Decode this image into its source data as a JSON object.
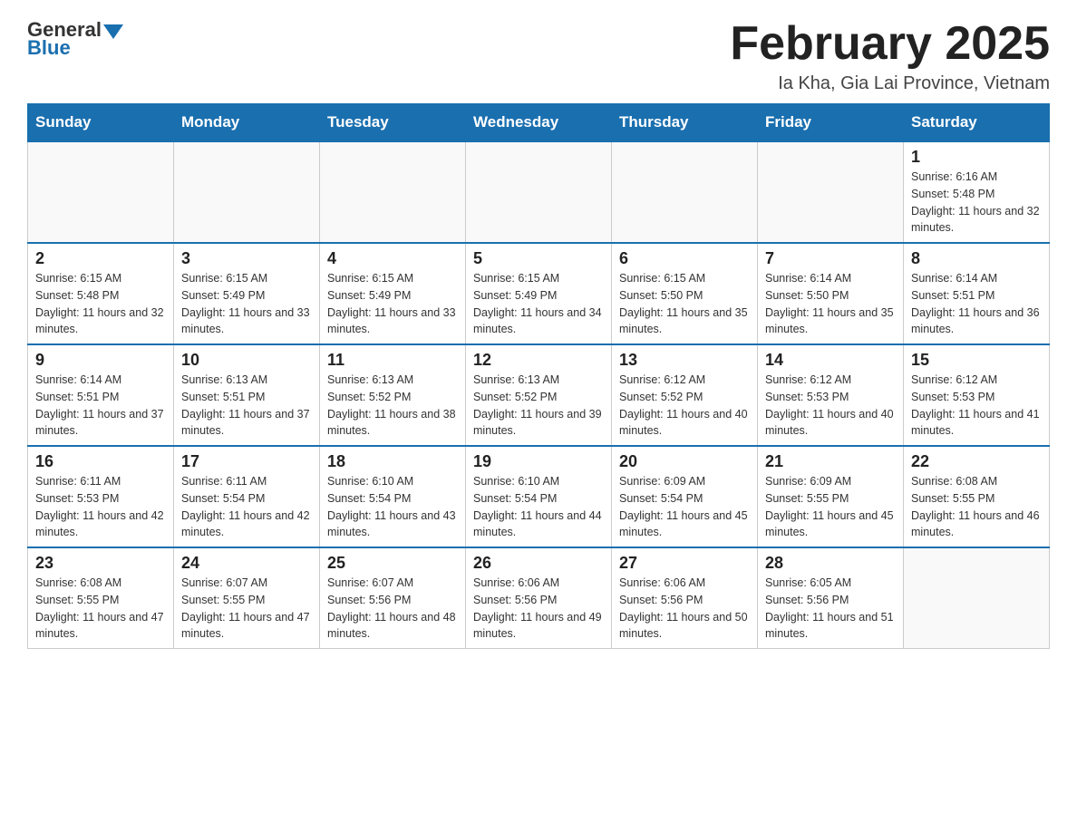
{
  "header": {
    "logo_general": "General",
    "logo_blue": "Blue",
    "month_title": "February 2025",
    "location": "Ia Kha, Gia Lai Province, Vietnam"
  },
  "days_of_week": [
    "Sunday",
    "Monday",
    "Tuesday",
    "Wednesday",
    "Thursday",
    "Friday",
    "Saturday"
  ],
  "weeks": [
    {
      "days": [
        {
          "number": "",
          "info": ""
        },
        {
          "number": "",
          "info": ""
        },
        {
          "number": "",
          "info": ""
        },
        {
          "number": "",
          "info": ""
        },
        {
          "number": "",
          "info": ""
        },
        {
          "number": "",
          "info": ""
        },
        {
          "number": "1",
          "info": "Sunrise: 6:16 AM\nSunset: 5:48 PM\nDaylight: 11 hours and 32 minutes."
        }
      ]
    },
    {
      "days": [
        {
          "number": "2",
          "info": "Sunrise: 6:15 AM\nSunset: 5:48 PM\nDaylight: 11 hours and 32 minutes."
        },
        {
          "number": "3",
          "info": "Sunrise: 6:15 AM\nSunset: 5:49 PM\nDaylight: 11 hours and 33 minutes."
        },
        {
          "number": "4",
          "info": "Sunrise: 6:15 AM\nSunset: 5:49 PM\nDaylight: 11 hours and 33 minutes."
        },
        {
          "number": "5",
          "info": "Sunrise: 6:15 AM\nSunset: 5:49 PM\nDaylight: 11 hours and 34 minutes."
        },
        {
          "number": "6",
          "info": "Sunrise: 6:15 AM\nSunset: 5:50 PM\nDaylight: 11 hours and 35 minutes."
        },
        {
          "number": "7",
          "info": "Sunrise: 6:14 AM\nSunset: 5:50 PM\nDaylight: 11 hours and 35 minutes."
        },
        {
          "number": "8",
          "info": "Sunrise: 6:14 AM\nSunset: 5:51 PM\nDaylight: 11 hours and 36 minutes."
        }
      ]
    },
    {
      "days": [
        {
          "number": "9",
          "info": "Sunrise: 6:14 AM\nSunset: 5:51 PM\nDaylight: 11 hours and 37 minutes."
        },
        {
          "number": "10",
          "info": "Sunrise: 6:13 AM\nSunset: 5:51 PM\nDaylight: 11 hours and 37 minutes."
        },
        {
          "number": "11",
          "info": "Sunrise: 6:13 AM\nSunset: 5:52 PM\nDaylight: 11 hours and 38 minutes."
        },
        {
          "number": "12",
          "info": "Sunrise: 6:13 AM\nSunset: 5:52 PM\nDaylight: 11 hours and 39 minutes."
        },
        {
          "number": "13",
          "info": "Sunrise: 6:12 AM\nSunset: 5:52 PM\nDaylight: 11 hours and 40 minutes."
        },
        {
          "number": "14",
          "info": "Sunrise: 6:12 AM\nSunset: 5:53 PM\nDaylight: 11 hours and 40 minutes."
        },
        {
          "number": "15",
          "info": "Sunrise: 6:12 AM\nSunset: 5:53 PM\nDaylight: 11 hours and 41 minutes."
        }
      ]
    },
    {
      "days": [
        {
          "number": "16",
          "info": "Sunrise: 6:11 AM\nSunset: 5:53 PM\nDaylight: 11 hours and 42 minutes."
        },
        {
          "number": "17",
          "info": "Sunrise: 6:11 AM\nSunset: 5:54 PM\nDaylight: 11 hours and 42 minutes."
        },
        {
          "number": "18",
          "info": "Sunrise: 6:10 AM\nSunset: 5:54 PM\nDaylight: 11 hours and 43 minutes."
        },
        {
          "number": "19",
          "info": "Sunrise: 6:10 AM\nSunset: 5:54 PM\nDaylight: 11 hours and 44 minutes."
        },
        {
          "number": "20",
          "info": "Sunrise: 6:09 AM\nSunset: 5:54 PM\nDaylight: 11 hours and 45 minutes."
        },
        {
          "number": "21",
          "info": "Sunrise: 6:09 AM\nSunset: 5:55 PM\nDaylight: 11 hours and 45 minutes."
        },
        {
          "number": "22",
          "info": "Sunrise: 6:08 AM\nSunset: 5:55 PM\nDaylight: 11 hours and 46 minutes."
        }
      ]
    },
    {
      "days": [
        {
          "number": "23",
          "info": "Sunrise: 6:08 AM\nSunset: 5:55 PM\nDaylight: 11 hours and 47 minutes."
        },
        {
          "number": "24",
          "info": "Sunrise: 6:07 AM\nSunset: 5:55 PM\nDaylight: 11 hours and 47 minutes."
        },
        {
          "number": "25",
          "info": "Sunrise: 6:07 AM\nSunset: 5:56 PM\nDaylight: 11 hours and 48 minutes."
        },
        {
          "number": "26",
          "info": "Sunrise: 6:06 AM\nSunset: 5:56 PM\nDaylight: 11 hours and 49 minutes."
        },
        {
          "number": "27",
          "info": "Sunrise: 6:06 AM\nSunset: 5:56 PM\nDaylight: 11 hours and 50 minutes."
        },
        {
          "number": "28",
          "info": "Sunrise: 6:05 AM\nSunset: 5:56 PM\nDaylight: 11 hours and 51 minutes."
        },
        {
          "number": "",
          "info": ""
        }
      ]
    }
  ]
}
